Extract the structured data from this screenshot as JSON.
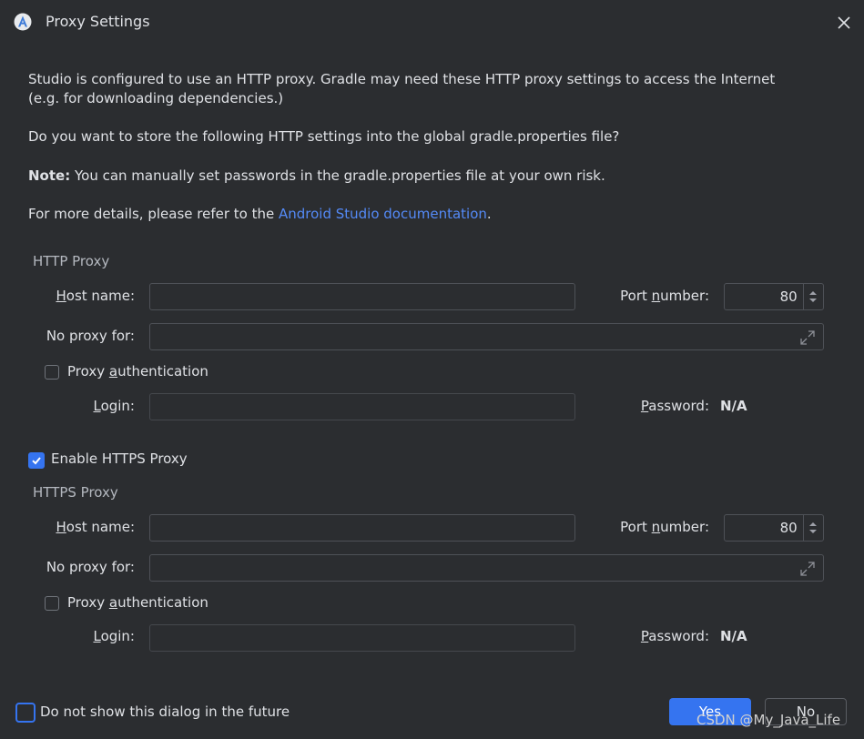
{
  "window": {
    "title": "Proxy Settings"
  },
  "intro": {
    "line1": "Studio is configured to use an HTTP proxy. Gradle may need these HTTP proxy settings to access the Internet",
    "line2": "(e.g. for downloading dependencies.)",
    "question": "Do you want to store the following HTTP settings into the global gradle.properties file?",
    "note_label": "Note:",
    "note_text": " You can manually set passwords in the gradle.properties file at your own risk.",
    "details_prefix": "For more details, please refer to the ",
    "details_link": "Android Studio documentation",
    "details_suffix": "."
  },
  "http": {
    "group_title": "HTTP Proxy",
    "host_label_u": "H",
    "host_label_rest": "ost name:",
    "host_value": "",
    "port_label_pre": "Port ",
    "port_label_u": "n",
    "port_label_rest": "umber:",
    "port_value": "80",
    "noproxy_label": "No proxy for:",
    "noproxy_value": "",
    "auth_label_pre": "Proxy ",
    "auth_label_u": "a",
    "auth_label_rest": "uthentication",
    "auth_checked": false,
    "login_label_u": "L",
    "login_label_rest": "ogin:",
    "login_value": "",
    "password_label_u": "P",
    "password_label_rest": "assword:",
    "password_value": "N/A"
  },
  "enable_https": {
    "label": "Enable HTTPS Proxy",
    "checked": true
  },
  "https": {
    "group_title": "HTTPS Proxy",
    "host_label_u": "H",
    "host_label_rest": "ost name:",
    "host_value": "",
    "port_label_pre": "Port ",
    "port_label_u": "n",
    "port_label_rest": "umber:",
    "port_value": "80",
    "noproxy_label": "No proxy for:",
    "noproxy_value": "",
    "auth_label_pre": "Proxy ",
    "auth_label_u": "a",
    "auth_label_rest": "uthentication",
    "auth_checked": false,
    "login_label_u": "L",
    "login_label_rest": "ogin:",
    "login_value": "",
    "password_label_u": "P",
    "password_label_rest": "assword:",
    "password_value": "N/A"
  },
  "footer": {
    "dont_show_label": "Do not show this dialog in the future",
    "yes_label": "Yes",
    "no_label": "No"
  },
  "watermark": "CSDN @My_Java_Life",
  "colors": {
    "background": "#2b2d30",
    "accent": "#3574f0",
    "link": "#548af7",
    "text": "#dfe1e5"
  },
  "icons": [
    "android-studio-icon",
    "close-icon",
    "spinner-icon",
    "expand-icon",
    "checkmark-icon"
  ]
}
